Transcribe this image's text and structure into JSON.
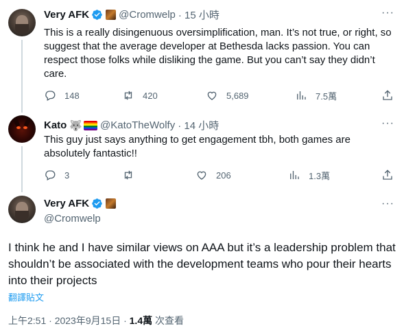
{
  "tweets": [
    {
      "name": "Very AFK",
      "handle": "@Cromwelp",
      "time": "· 15 小時",
      "text": "This is a really disingenuous oversimplification, man. It’s not true, or right, so suggest that the average developer at Bethesda lacks passion. You can respect those folks while disliking the game. But you can’t say they didn’t care.",
      "replies": "148",
      "retweets": "420",
      "likes": "5,689",
      "views": "7.5萬"
    },
    {
      "name": "Kato",
      "handle": "@KatoTheWolfy",
      "time": "· 14 小時",
      "text": "This guy just says anything to get engagement tbh, both games are absolutely fantastic!!",
      "replies": "3",
      "retweets": "",
      "likes": "206",
      "views": "1.3萬"
    }
  ],
  "main": {
    "name": "Very AFK",
    "handle": "@Cromwelp",
    "text": "I think he and I have similar views on AAA but it’s a leadership problem that shouldn’t be associated with the development teams who pour their hearts into their projects",
    "translate_label": "翻譯貼文",
    "timestamp": "上午2:51 · 2023年9月15日 · ",
    "views_count": "1.4萬",
    "views_label": " 次查看"
  },
  "icons": {
    "reply": "reply-icon",
    "retweet": "retweet-icon",
    "like": "heart-icon",
    "views": "views-icon",
    "share": "share-icon",
    "more": "more-icon",
    "verified": "verified-icon"
  },
  "colors": {
    "accent": "#1d9bf0",
    "muted": "#536471",
    "thread_line": "#cfd9de"
  }
}
